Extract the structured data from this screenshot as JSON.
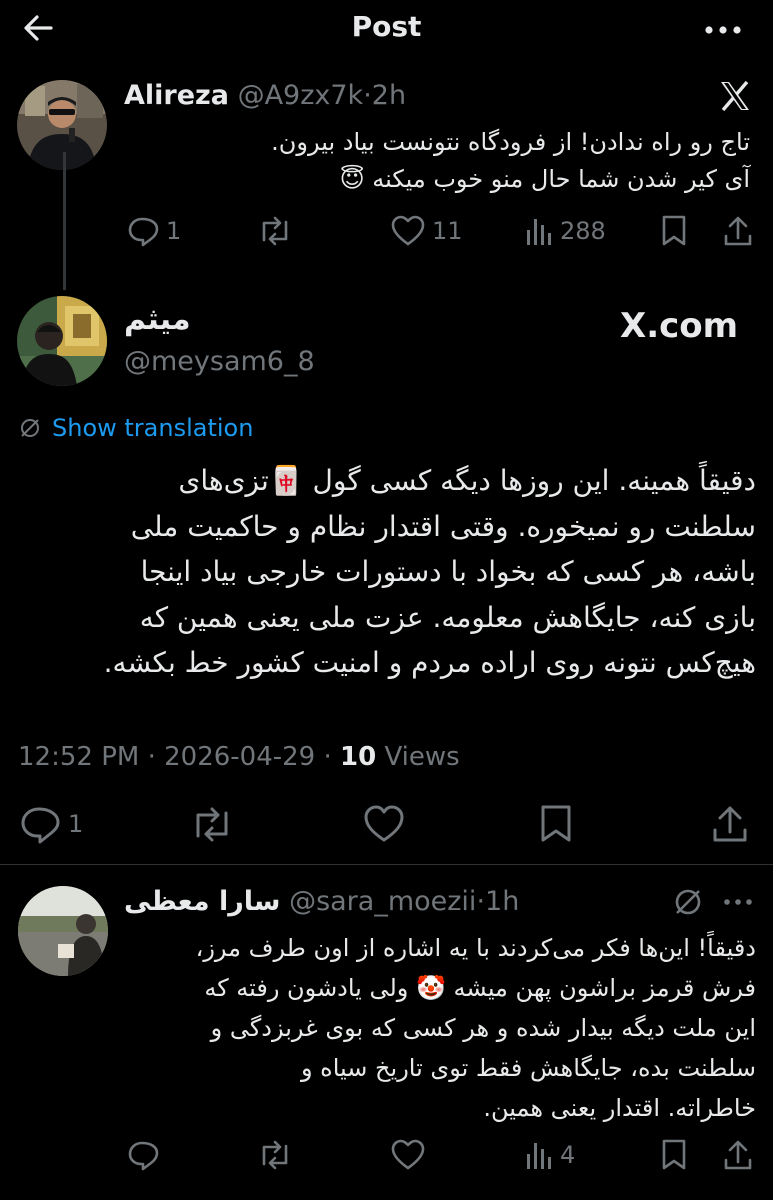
{
  "header": {
    "title": "Post"
  },
  "reply_parent": {
    "name": "Alireza",
    "handle": "@A9zx7k",
    "sep": "·",
    "time": "2h",
    "line1": "تاج رو راه ندادن! از فرودگاه نتونست بیاد بیرون.",
    "line2": "آی کیر شدن شما حال منو خوب میکنه 😇",
    "replies": "1",
    "likes": "11",
    "views": "288"
  },
  "main_post": {
    "name": "میثم",
    "handle": "@meysam6_8",
    "brand": "X.com",
    "show_translation": "Show translation",
    "lines": [
      "دقیقاً همینه. این روزها دیگه کسی گول 🀄تزی‌های",
      "سلطنت رو نمیخوره. وقتی اقتدار نظام و حاکمیت ملی",
      "باشه، هر کسی که بخواد با دستورات خارجی بیاد اینجا",
      "بازی کنه، جایگاهش معلومه. عزت ملی یعنی همین که",
      "هیچ‌کس نتونه روی اراده مردم و امنیت کشور خط بکشه."
    ],
    "time": "12:52 PM",
    "dot": "·",
    "date": "2026-04-29",
    "views_count": "10",
    "views_label": "Views",
    "replies": "1"
  },
  "reply": {
    "name": "سارا معظی",
    "handle": "@sara_moezii",
    "sep": "·",
    "time": "1h",
    "lines": [
      "دقیقاً! این‌ها فکر می‌کردند با یه اشاره از اون طرف مرز،",
      "فرش قرمز براشون پهن میشه 🤡 ولی یادشون رفته که",
      "این ملت دیگه بیدار شده و هر کسی که بوی غربزدگی و",
      "سلطنت بده، جایگاهش فقط توی تاریخ سیاه و",
      "خاطراته. اقتدار یعنی همین."
    ],
    "views": "4"
  },
  "colors": {
    "background": "#000000",
    "text": "#e7e9ea",
    "muted": "#71767b",
    "link": "#1d9bf0"
  }
}
